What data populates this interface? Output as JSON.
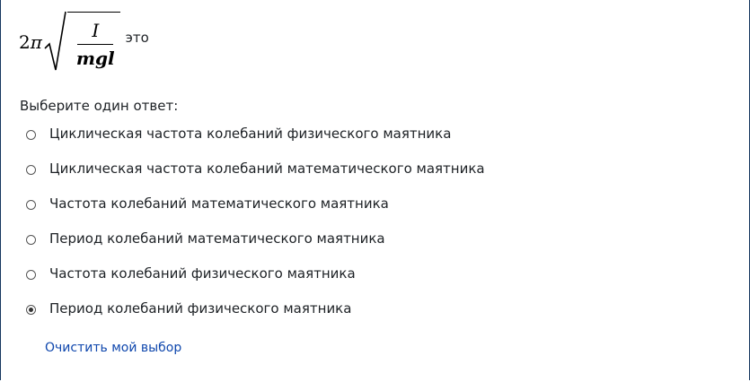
{
  "question": {
    "formula": {
      "coefficient": "2",
      "pi": "π",
      "numerator": "I",
      "denominator": "mgl"
    },
    "after_text": "это",
    "prompt": "Выберите один ответ:"
  },
  "answers": [
    {
      "label": "Циклическая частота колебаний физического маятника",
      "selected": false
    },
    {
      "label": "Циклическая частота колебаний математического маятника",
      "selected": false
    },
    {
      "label": "Частота колебаний математического маятника",
      "selected": false
    },
    {
      "label": "Период колебаний математического маятника",
      "selected": false
    },
    {
      "label": "Частота колебаний физического маятника",
      "selected": false
    },
    {
      "label": "Период колебаний физического маятника",
      "selected": true
    }
  ],
  "clear_link": "Очистить мой выбор",
  "colors": {
    "link": "#0f47ad",
    "border": "#16365f",
    "text": "#1d2125"
  }
}
